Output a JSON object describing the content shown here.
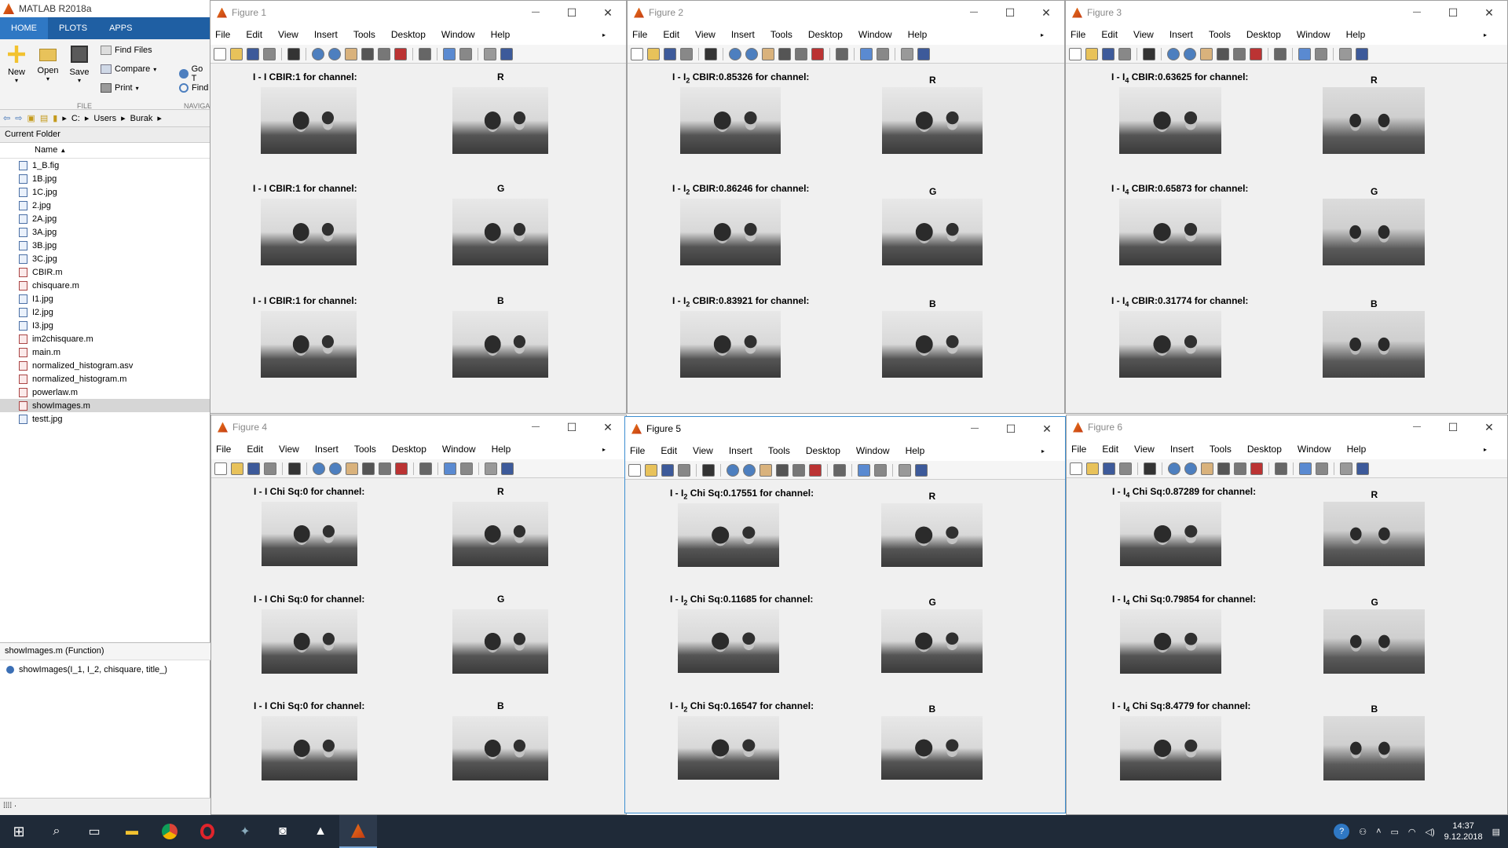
{
  "matlab": {
    "title": "MATLAB R2018a",
    "tabs": [
      "HOME",
      "PLOTS",
      "APPS"
    ],
    "ribbon": {
      "new": "New",
      "open": "Open",
      "save": "Save",
      "find_files": "Find Files",
      "compare": "Compare",
      "print": "Print",
      "goto": "Go T",
      "find": "Find",
      "section_file": "FILE",
      "section_nav": "NAVIGA"
    },
    "path": [
      "C:",
      "Users",
      "Burak"
    ],
    "current_folder_label": "Current Folder",
    "name_col": "Name",
    "files": [
      {
        "name": "1_B.fig",
        "type": "fig"
      },
      {
        "name": "1B.jpg",
        "type": "img"
      },
      {
        "name": "1C.jpg",
        "type": "img"
      },
      {
        "name": "2.jpg",
        "type": "img"
      },
      {
        "name": "2A.jpg",
        "type": "img"
      },
      {
        "name": "3A.jpg",
        "type": "img"
      },
      {
        "name": "3B.jpg",
        "type": "img"
      },
      {
        "name": "3C.jpg",
        "type": "img"
      },
      {
        "name": "CBIR.m",
        "type": "m"
      },
      {
        "name": "chisquare.m",
        "type": "m"
      },
      {
        "name": "I1.jpg",
        "type": "img"
      },
      {
        "name": "I2.jpg",
        "type": "img"
      },
      {
        "name": "I3.jpg",
        "type": "img"
      },
      {
        "name": "im2chisquare.m",
        "type": "m"
      },
      {
        "name": "main.m",
        "type": "m"
      },
      {
        "name": "normalized_histogram.asv",
        "type": "m"
      },
      {
        "name": "normalized_histogram.m",
        "type": "m"
      },
      {
        "name": "powerlaw.m",
        "type": "m"
      },
      {
        "name": "showImages.m",
        "type": "m",
        "selected": true
      },
      {
        "name": "testt.jpg",
        "type": "img"
      }
    ],
    "details_header": "showImages.m  (Function)",
    "details_signature": "showImages(I_1, I_2, chisquare, title_)"
  },
  "menu": [
    "File",
    "Edit",
    "View",
    "Insert",
    "Tools",
    "Desktop",
    "Window",
    "Help"
  ],
  "figures": [
    {
      "title": "Figure 1",
      "rows": [
        {
          "pre": "I - I CBIR:1 for channel:",
          "sub": "",
          "post": "",
          "ch": "R"
        },
        {
          "pre": "I - I CBIR:1 for channel:",
          "sub": "",
          "post": "",
          "ch": "G"
        },
        {
          "pre": "I - I CBIR:1 for channel:",
          "sub": "",
          "post": "",
          "ch": "B"
        }
      ]
    },
    {
      "title": "Figure 2",
      "rows": [
        {
          "pre": "I - I",
          "sub": "2",
          "post": " CBIR:0.85326 for channel:",
          "ch": "R"
        },
        {
          "pre": "I - I",
          "sub": "2",
          "post": " CBIR:0.86246 for channel:",
          "ch": "G"
        },
        {
          "pre": "I - I",
          "sub": "2",
          "post": " CBIR:0.83921 for channel:",
          "ch": "B"
        }
      ]
    },
    {
      "title": "Figure 3",
      "rows": [
        {
          "pre": "I - I",
          "sub": "4",
          "post": " CBIR:0.63625 for channel:",
          "ch": "R"
        },
        {
          "pre": "I - I",
          "sub": "4",
          "post": " CBIR:0.65873 for channel:",
          "ch": "G"
        },
        {
          "pre": "I - I",
          "sub": "4",
          "post": " CBIR:0.31774 for channel:",
          "ch": "B"
        }
      ]
    },
    {
      "title": "Figure 4",
      "rows": [
        {
          "pre": "I - I Chi Sq:0 for channel:",
          "sub": "",
          "post": "",
          "ch": "R"
        },
        {
          "pre": "I - I Chi Sq:0 for channel:",
          "sub": "",
          "post": "",
          "ch": "G"
        },
        {
          "pre": "I - I Chi Sq:0 for channel:",
          "sub": "",
          "post": "",
          "ch": "B"
        }
      ]
    },
    {
      "title": "Figure 5",
      "rows": [
        {
          "pre": "I - I",
          "sub": "2",
          "post": " Chi Sq:0.17551 for channel:",
          "ch": "R"
        },
        {
          "pre": "I - I",
          "sub": "2",
          "post": " Chi Sq:0.11685 for channel:",
          "ch": "G"
        },
        {
          "pre": "I - I",
          "sub": "2",
          "post": " Chi Sq:0.16547 for channel:",
          "ch": "B"
        }
      ]
    },
    {
      "title": "Figure 6",
      "rows": [
        {
          "pre": "I - I",
          "sub": "4",
          "post": " Chi Sq:0.87289 for channel:",
          "ch": "R"
        },
        {
          "pre": "I - I",
          "sub": "4",
          "post": " Chi Sq:0.79854 for channel:",
          "ch": "G"
        },
        {
          "pre": "I - I",
          "sub": "4",
          "post": " Chi Sq:8.4779 for channel:",
          "ch": "B"
        }
      ]
    }
  ],
  "taskbar": {
    "time": "14:37",
    "date": "9.12.2018"
  }
}
